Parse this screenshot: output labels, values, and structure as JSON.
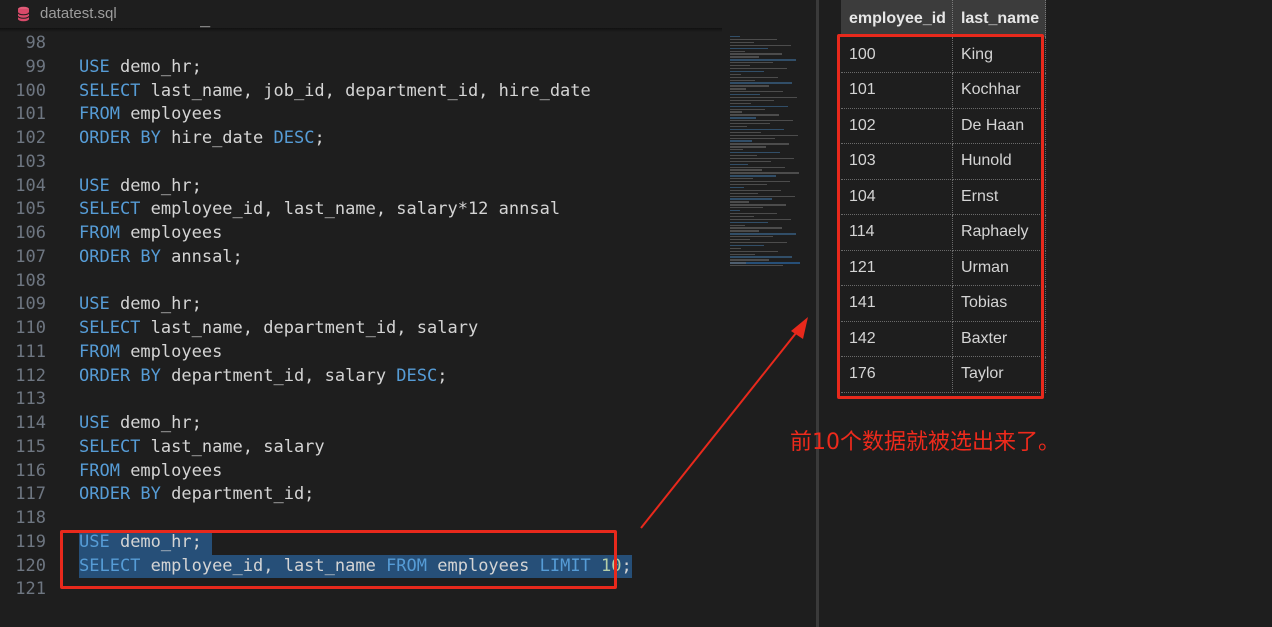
{
  "tab": {
    "title": "datatest.sql",
    "icon": "database-icon"
  },
  "sticky_fragment": "_",
  "code_lines": [
    {
      "no": "98",
      "tokens": []
    },
    {
      "no": "99",
      "tokens": [
        {
          "t": "USE",
          "k": "kw"
        },
        {
          "t": " demo_hr;"
        }
      ]
    },
    {
      "no": "100",
      "tokens": [
        {
          "t": "SELECT",
          "k": "kw"
        },
        {
          "t": " last_name, job_id, department_id, hire_date"
        }
      ]
    },
    {
      "no": "101",
      "tokens": [
        {
          "t": "FROM",
          "k": "kw"
        },
        {
          "t": " employees"
        }
      ]
    },
    {
      "no": "102",
      "tokens": [
        {
          "t": "ORDER BY",
          "k": "kw"
        },
        {
          "t": " hire_date "
        },
        {
          "t": "DESC",
          "k": "kw"
        },
        {
          "t": ";"
        }
      ]
    },
    {
      "no": "103",
      "tokens": []
    },
    {
      "no": "104",
      "tokens": [
        {
          "t": "USE",
          "k": "kw"
        },
        {
          "t": " demo_hr;"
        }
      ]
    },
    {
      "no": "105",
      "tokens": [
        {
          "t": "SELECT",
          "k": "kw"
        },
        {
          "t": " employee_id, last_name, salary*12 annsal"
        }
      ]
    },
    {
      "no": "106",
      "tokens": [
        {
          "t": "FROM",
          "k": "kw"
        },
        {
          "t": " employees"
        }
      ]
    },
    {
      "no": "107",
      "tokens": [
        {
          "t": "ORDER BY",
          "k": "kw"
        },
        {
          "t": " annsal;"
        }
      ]
    },
    {
      "no": "108",
      "tokens": []
    },
    {
      "no": "109",
      "tokens": [
        {
          "t": "USE",
          "k": "kw"
        },
        {
          "t": " demo_hr;"
        }
      ]
    },
    {
      "no": "110",
      "tokens": [
        {
          "t": "SELECT",
          "k": "kw"
        },
        {
          "t": " last_name, department_id, salary"
        }
      ]
    },
    {
      "no": "111",
      "tokens": [
        {
          "t": "FROM",
          "k": "kw"
        },
        {
          "t": " employees"
        }
      ]
    },
    {
      "no": "112",
      "tokens": [
        {
          "t": "ORDER BY",
          "k": "kw"
        },
        {
          "t": " department_id, salary "
        },
        {
          "t": "DESC",
          "k": "kw"
        },
        {
          "t": ";"
        }
      ]
    },
    {
      "no": "113",
      "tokens": []
    },
    {
      "no": "114",
      "tokens": [
        {
          "t": "USE",
          "k": "kw"
        },
        {
          "t": " demo_hr;"
        }
      ]
    },
    {
      "no": "115",
      "tokens": [
        {
          "t": "SELECT",
          "k": "kw"
        },
        {
          "t": " last_name, salary"
        }
      ]
    },
    {
      "no": "116",
      "tokens": [
        {
          "t": "FROM",
          "k": "kw"
        },
        {
          "t": " employees"
        }
      ]
    },
    {
      "no": "117",
      "tokens": [
        {
          "t": "ORDER BY",
          "k": "kw"
        },
        {
          "t": " department_id;"
        }
      ]
    },
    {
      "no": "118",
      "tokens": []
    },
    {
      "no": "119",
      "selected": true,
      "tokens": [
        {
          "t": "USE",
          "k": "kw"
        },
        {
          "t": " demo_hr; "
        }
      ]
    },
    {
      "no": "120",
      "selected": true,
      "tokens": [
        {
          "t": "SELECT",
          "k": "kw"
        },
        {
          "t": " employee_id, last_name "
        },
        {
          "t": "FROM",
          "k": "kw"
        },
        {
          "t": " employees "
        },
        {
          "t": "LIMIT",
          "k": "kw"
        },
        {
          "t": " "
        },
        {
          "t": "10",
          "k": "num"
        },
        {
          "t": ";"
        }
      ]
    },
    {
      "no": "121",
      "tokens": []
    }
  ],
  "results": {
    "columns": [
      "employee_id",
      "last_name"
    ],
    "rows": [
      [
        "100",
        "King"
      ],
      [
        "101",
        "Kochhar"
      ],
      [
        "102",
        "De Haan"
      ],
      [
        "103",
        "Hunold"
      ],
      [
        "104",
        "Ernst"
      ],
      [
        "114",
        "Raphaely"
      ],
      [
        "121",
        "Urman"
      ],
      [
        "141",
        "Tobias"
      ],
      [
        "142",
        "Baxter"
      ],
      [
        "176",
        "Taylor"
      ]
    ]
  },
  "annotation": "前10个数据就被选出来了。",
  "colors": {
    "keyword": "#569cd6",
    "number": "#b5cea8",
    "selection": "#264f78",
    "highlight_red": "#e8291c"
  }
}
